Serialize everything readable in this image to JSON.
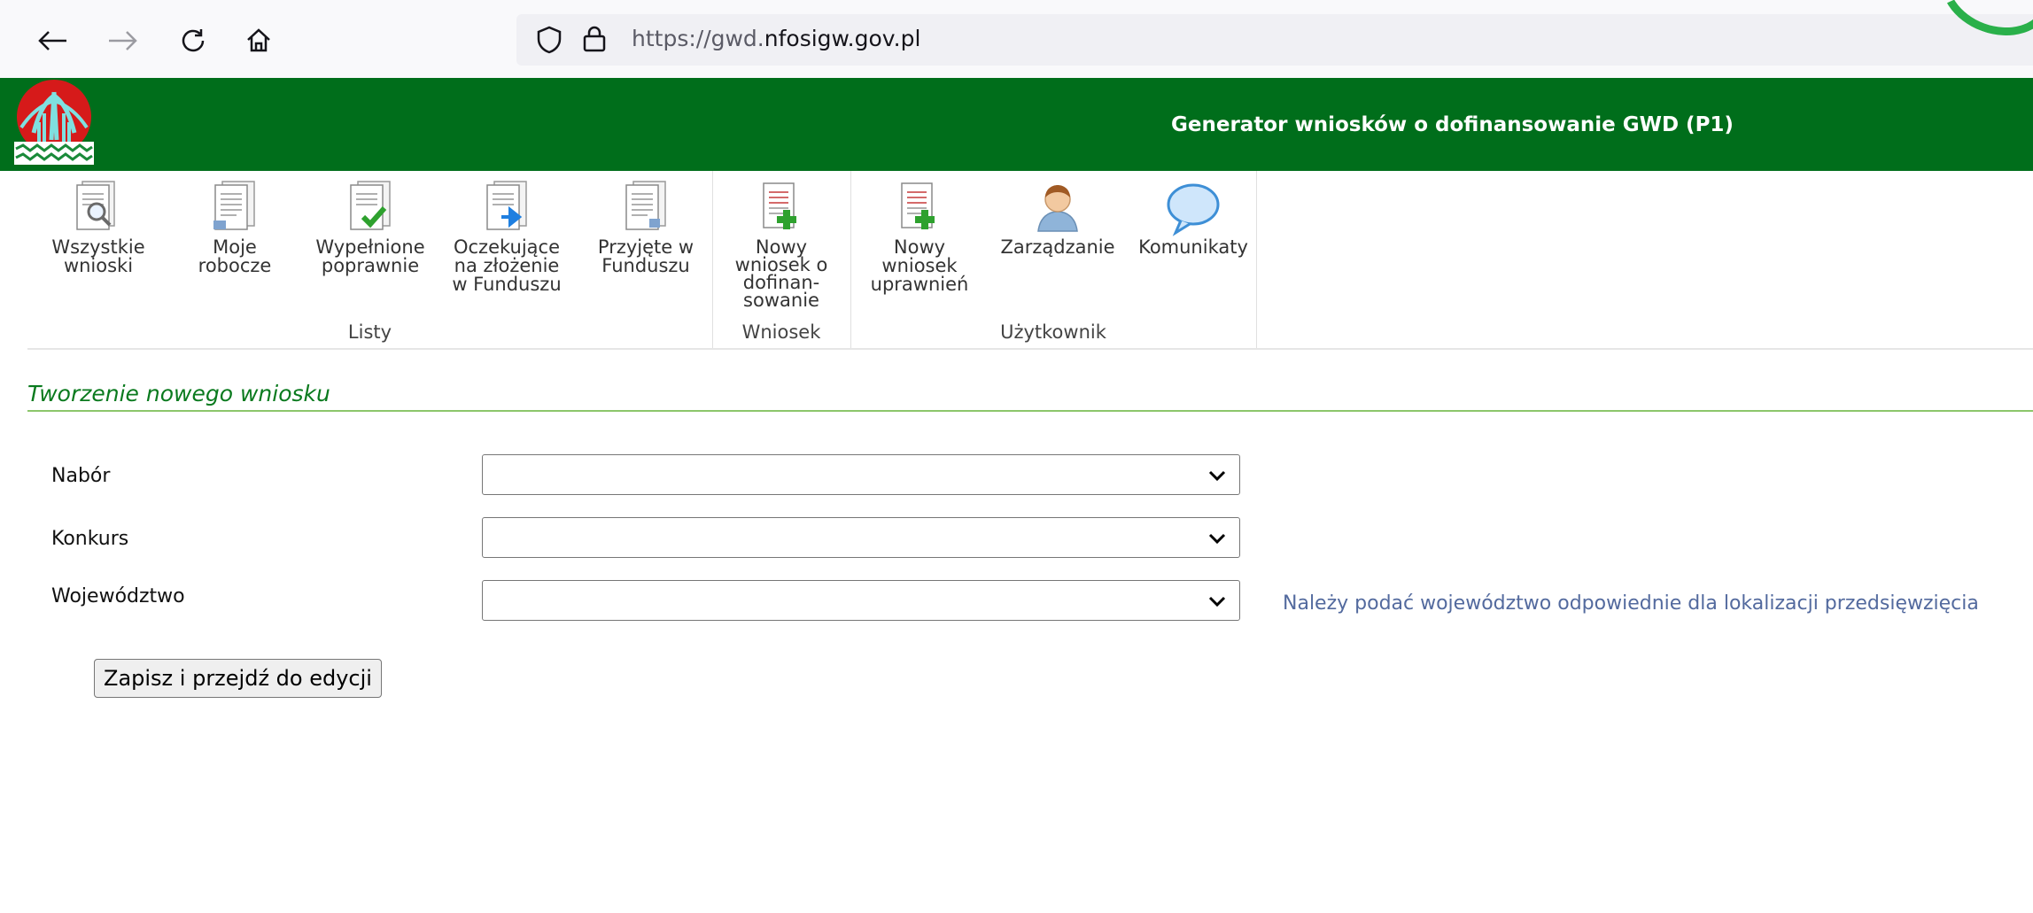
{
  "browser": {
    "url_prefix": "https://gwd.",
    "url_domain": "nfosigw.gov.pl"
  },
  "header": {
    "title": "Generator wniosków o dofinansowanie GWD (P1)"
  },
  "ribbon": {
    "groups": [
      {
        "label": "Listy"
      },
      {
        "label": "Wniosek"
      },
      {
        "label": "Użytkownik"
      }
    ],
    "items": [
      {
        "label": "Wszystkie\nwnioski",
        "icon": "all-applications-icon"
      },
      {
        "label": "Moje\nrobocze",
        "icon": "drafts-icon"
      },
      {
        "label": "Wypełnione\npoprawnie",
        "icon": "completed-icon"
      },
      {
        "label": "Oczekujące\nna złożenie\nw Funduszu",
        "icon": "pending-icon"
      },
      {
        "label": "Przyjęte w\nFunduszu",
        "icon": "accepted-icon"
      },
      {
        "label": "Nowy\nwniosek o\ndofinan-\nsowanie",
        "icon": "new-funding-application-icon"
      },
      {
        "label": "Nowy\nwniosek\nuprawnień",
        "icon": "new-permissions-application-icon"
      },
      {
        "label": "Zarządzanie",
        "icon": "user-icon"
      },
      {
        "label": "Komunikaty",
        "icon": "speech-bubble-icon"
      }
    ]
  },
  "section": {
    "title": "Tworzenie nowego wniosku"
  },
  "form": {
    "nabor_label": "Nabór",
    "nabor_value": "",
    "konkurs_label": "Konkurs",
    "konkurs_value": "",
    "wojewodztwo_label": "Województwo",
    "wojewodztwo_value": "",
    "wojewodztwo_hint": "Należy podać województwo odpowiednie dla lokalizacji przedsięwzięcia",
    "submit_label": "Zapisz i przejdź do edycji"
  },
  "colors": {
    "header_green": "#006e1b",
    "section_green": "#0a7a1e",
    "hint_blue": "#536a9e"
  }
}
